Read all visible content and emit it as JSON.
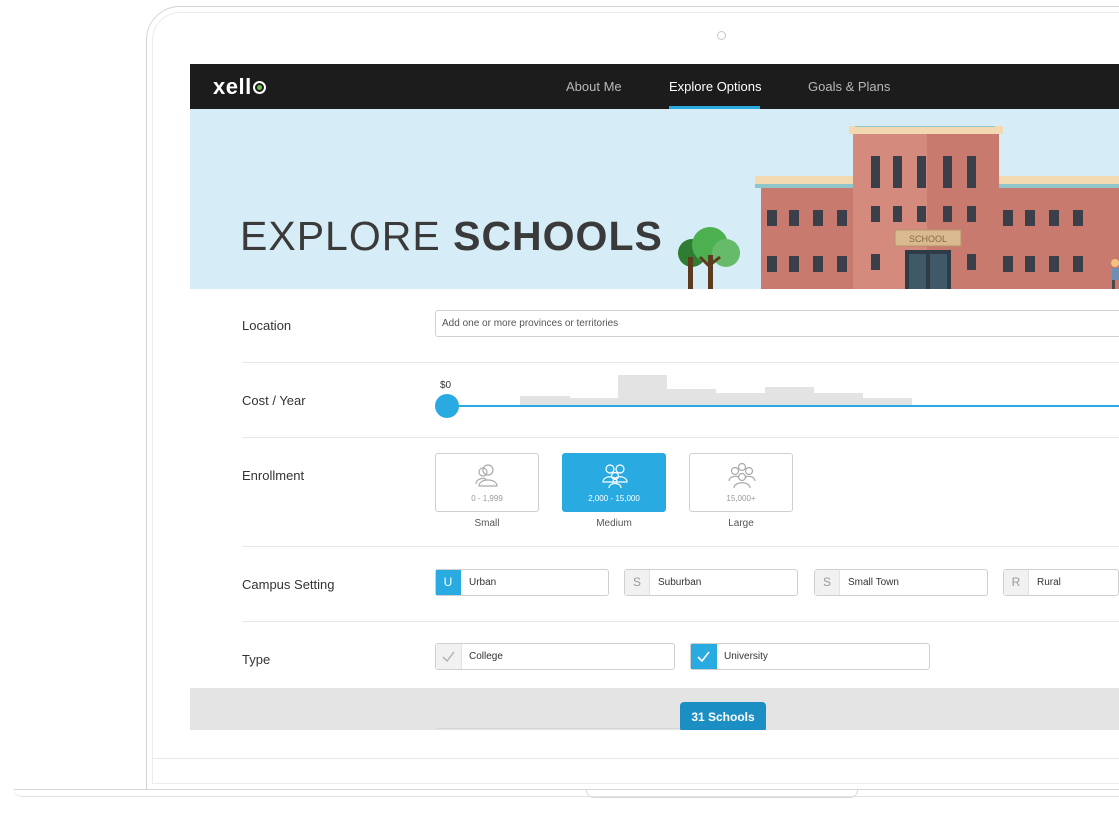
{
  "app": {
    "logo": "xell"
  },
  "nav": {
    "items": [
      "About Me",
      "Explore Options",
      "Goals & Plans"
    ],
    "active": "Explore Options"
  },
  "hero": {
    "title_light": "EXPLORE ",
    "title_bold": "SCHOOLS",
    "building_sign": "SCHOOL"
  },
  "filters": {
    "location": {
      "label": "Location",
      "placeholder": "Add one or more provinces or territories"
    },
    "cost": {
      "label": "Cost / Year",
      "min_label": "$0",
      "selected_min_fraction": 0
    },
    "enrollment": {
      "label": "Enrollment",
      "options": [
        {
          "range": "0 - 1,999",
          "name": "Small",
          "selected": false
        },
        {
          "range": "2,000 - 15,000",
          "name": "Medium",
          "selected": true
        },
        {
          "range": "15,000+",
          "name": "Large",
          "selected": false
        }
      ]
    },
    "campus_setting": {
      "label": "Campus Setting",
      "options": [
        {
          "letter": "U",
          "name": "Urban",
          "selected": true
        },
        {
          "letter": "S",
          "name": "Suburban",
          "selected": false
        },
        {
          "letter": "S",
          "name": "Small Town",
          "selected": false
        },
        {
          "letter": "R",
          "name": "Rural",
          "selected": false
        }
      ]
    },
    "type": {
      "label": "Type",
      "options": [
        {
          "name": "College",
          "selected": false
        },
        {
          "name": "University",
          "selected": true
        }
      ]
    }
  },
  "results": {
    "button_label": "31 Schools"
  },
  "colors": {
    "accent": "#29abe2",
    "topbar": "#1c1c1c",
    "hero_bg": "#d6ecf6",
    "brick": "#c97a6e"
  }
}
